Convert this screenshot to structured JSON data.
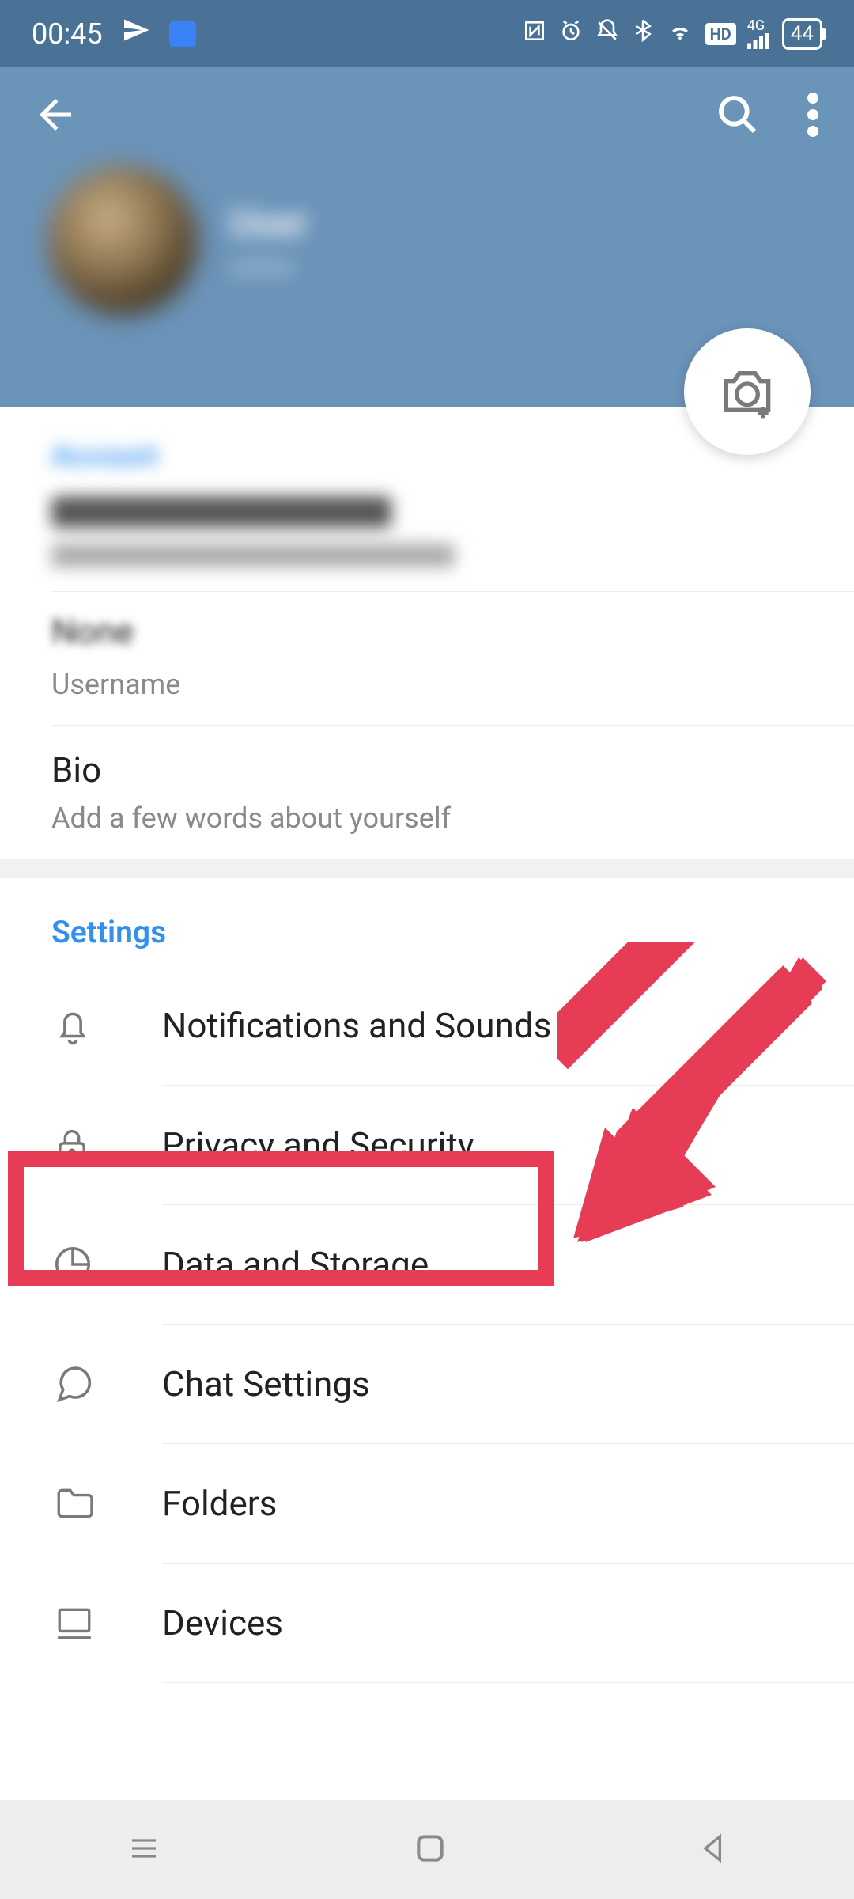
{
  "status": {
    "time": "00:45",
    "battery": "44"
  },
  "profile": {
    "name": "User",
    "status": "online"
  },
  "account": {
    "section_label": "Account",
    "username_value": "None",
    "username_label": "Username",
    "bio_value": "Bio",
    "bio_hint": "Add a few words about yourself"
  },
  "settings": {
    "section_label": "Settings",
    "notifications": "Notifications and Sounds",
    "privacy": "Privacy and Security",
    "data": "Data and Storage",
    "chat": "Chat Settings",
    "folders": "Folders",
    "devices": "Devices"
  }
}
